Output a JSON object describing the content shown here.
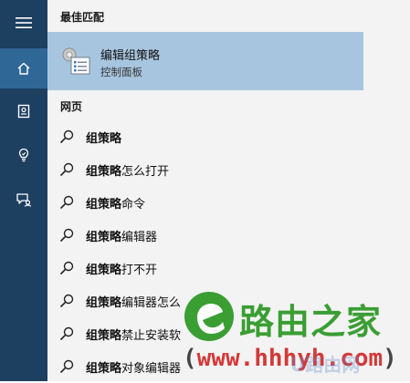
{
  "sidebar": {
    "items": [
      {
        "icon": "hamburger-menu-icon"
      },
      {
        "icon": "home-icon",
        "active": true
      },
      {
        "icon": "notebook-icon"
      },
      {
        "icon": "lightbulb-icon"
      },
      {
        "icon": "feedback-icon"
      }
    ]
  },
  "best_match": {
    "header": "最佳匹配",
    "title": "编辑组策略",
    "subtitle": "控制面板",
    "icon": "group-policy-editor-icon"
  },
  "web": {
    "header": "网页",
    "items": [
      {
        "bold": "组策略",
        "rest": ""
      },
      {
        "bold": "组策略",
        "rest": "怎么打开"
      },
      {
        "bold": "组策略",
        "rest": "命令"
      },
      {
        "bold": "组策略",
        "rest": "编辑器"
      },
      {
        "bold": "组策略",
        "rest": "打不开"
      },
      {
        "bold": "组策略",
        "rest": "编辑器怎么"
      },
      {
        "bold": "组策略",
        "rest": "禁止安装软"
      },
      {
        "bold": "组策略",
        "rest": "对象编辑器"
      }
    ]
  },
  "watermark": {
    "site_name": "路由之家",
    "url_prefix": "(",
    "url_main": "www.hhhyh.com",
    "url_suffix": ")",
    "badge": "U路由网"
  },
  "colors": {
    "sidebar": "#1d3f60",
    "sidebar_active": "#2f6797",
    "panel": "#f3f3f3",
    "highlight": "#a7c5df",
    "watermark_green": "#3a9e33",
    "watermark_red": "#d43838"
  }
}
